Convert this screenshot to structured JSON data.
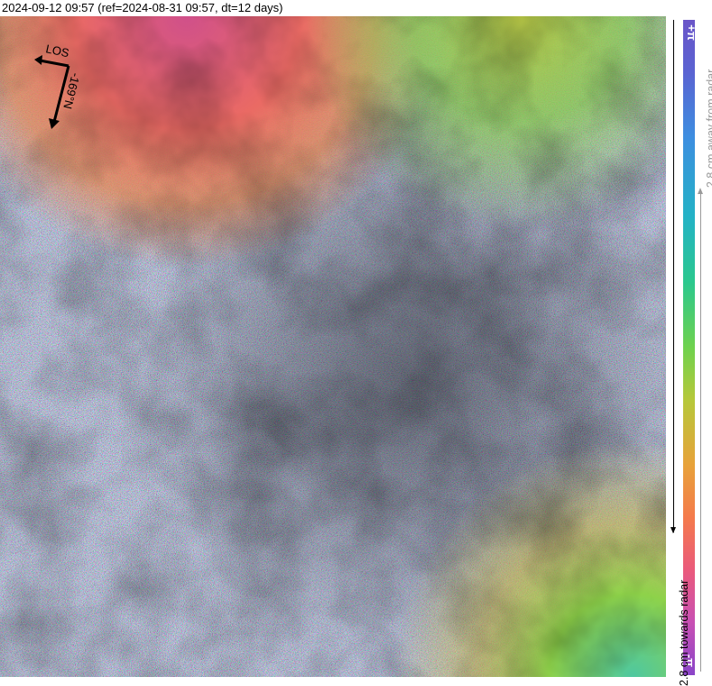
{
  "header": {
    "title": "2024-09-12 09:57 (ref=2024-08-31 09:57, dt=12 days)"
  },
  "compass": {
    "los_label": "LOS",
    "heading_label": "-169°N"
  },
  "colorbar": {
    "max_label": "+π",
    "min_label": "-π",
    "away_label": "2.8 cm away from radar",
    "towards_label": "2.8 cm towards radar",
    "colors": [
      "#6a55c8",
      "#3d8ee0",
      "#2bc88e",
      "#6fd24e",
      "#b6c83a",
      "#f47a4c",
      "#ea5a7c",
      "#8a45c8"
    ]
  },
  "map": {
    "type": "interferogram-phase",
    "noise_color": "#6e6a78",
    "fringe_colors": {
      "top_left": "#e05a6e",
      "top_right": "#a8c84a",
      "bottom_right": "#8ac84e"
    }
  }
}
